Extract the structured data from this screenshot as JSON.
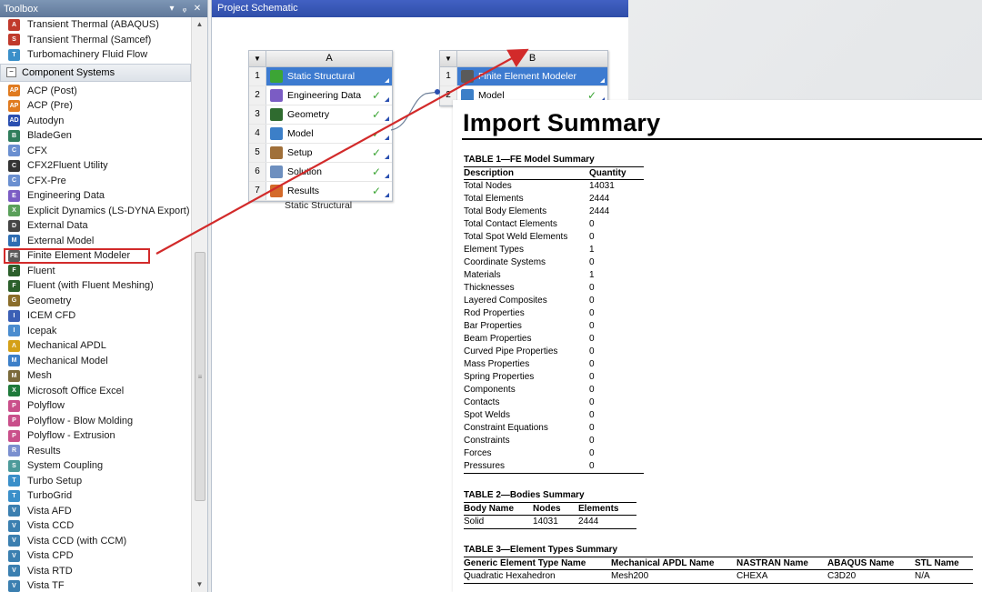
{
  "toolbox": {
    "title": "Toolbox",
    "pin_glyph": "▾",
    "dock_glyph": "ᵩ",
    "close_glyph": "✕",
    "top_items": [
      {
        "label": "Transient Thermal (ABAQUS)",
        "icon": "ansys-icon",
        "color": "#c0392b",
        "glyph": "A"
      },
      {
        "label": "Transient Thermal (Samcef)",
        "icon": "ansys-icon",
        "color": "#c0392b",
        "glyph": "S"
      },
      {
        "label": "Turbomachinery Fluid Flow",
        "icon": "turbo-icon",
        "color": "#3a8fc9",
        "glyph": "T"
      }
    ],
    "group": {
      "label": "Component Systems",
      "toggle": "−"
    },
    "items": [
      {
        "label": "ACP (Post)",
        "icon": "acp-icon",
        "color": "#e07b20",
        "glyph": "AP"
      },
      {
        "label": "ACP (Pre)",
        "icon": "acp-icon",
        "color": "#e07b20",
        "glyph": "AP"
      },
      {
        "label": "Autodyn",
        "icon": "autodyn-icon",
        "color": "#2a4fb0",
        "glyph": "AD"
      },
      {
        "label": "BladeGen",
        "icon": "bladegen-icon",
        "color": "#2f7d5b",
        "glyph": "B"
      },
      {
        "label": "CFX",
        "icon": "cfx-icon",
        "color": "#6a8fd0",
        "glyph": "C"
      },
      {
        "label": "CFX2Fluent Utility",
        "icon": "cfx2fluent-icon",
        "color": "#333333",
        "glyph": "C"
      },
      {
        "label": "CFX-Pre",
        "icon": "cfx-pre-icon",
        "color": "#6a8fd0",
        "glyph": "C"
      },
      {
        "label": "Engineering Data",
        "icon": "engineering-data-icon",
        "color": "#7b5cc4",
        "glyph": "E"
      },
      {
        "label": "Explicit Dynamics (LS-DYNA Export)",
        "icon": "explicit-dynamics-icon",
        "color": "#5aa05a",
        "glyph": "X"
      },
      {
        "label": "External Data",
        "icon": "external-data-icon",
        "color": "#444444",
        "glyph": "D"
      },
      {
        "label": "External Model",
        "icon": "external-model-icon",
        "color": "#2e6db3",
        "glyph": "M"
      },
      {
        "label": "Finite Element Modeler",
        "icon": "fe-modeler-icon",
        "color": "#5a5a5a",
        "glyph": "FE",
        "highlight": true
      },
      {
        "label": "Fluent",
        "icon": "fluent-icon",
        "color": "#2b5f2b",
        "glyph": "F"
      },
      {
        "label": "Fluent (with Fluent Meshing)",
        "icon": "fluent-icon",
        "color": "#2b5f2b",
        "glyph": "F"
      },
      {
        "label": "Geometry",
        "icon": "geometry-icon",
        "color": "#8a6d2a",
        "glyph": "G"
      },
      {
        "label": "ICEM CFD",
        "icon": "icem-icon",
        "color": "#3b5fb5",
        "glyph": "I"
      },
      {
        "label": "Icepak",
        "icon": "icepak-icon",
        "color": "#4a8ccf",
        "glyph": "I"
      },
      {
        "label": "Mechanical APDL",
        "icon": "mechanical-apdl-icon",
        "color": "#d4a017",
        "glyph": "Λ"
      },
      {
        "label": "Mechanical Model",
        "icon": "mechanical-model-icon",
        "color": "#3c7fc8",
        "glyph": "M"
      },
      {
        "label": "Mesh",
        "icon": "mesh-icon",
        "color": "#7a6a3a",
        "glyph": "M"
      },
      {
        "label": "Microsoft Office Excel",
        "icon": "excel-icon",
        "color": "#1e7a3a",
        "glyph": "X"
      },
      {
        "label": "Polyflow",
        "icon": "polyflow-icon",
        "color": "#c94f8a",
        "glyph": "P"
      },
      {
        "label": "Polyflow - Blow Molding",
        "icon": "polyflow-icon",
        "color": "#c94f8a",
        "glyph": "P"
      },
      {
        "label": "Polyflow - Extrusion",
        "icon": "polyflow-icon",
        "color": "#c94f8a",
        "glyph": "P"
      },
      {
        "label": "Results",
        "icon": "results-icon",
        "color": "#7a8fcf",
        "glyph": "R"
      },
      {
        "label": "System Coupling",
        "icon": "system-coupling-icon",
        "color": "#4c9a9a",
        "glyph": "S"
      },
      {
        "label": "Turbo Setup",
        "icon": "turbo-setup-icon",
        "color": "#3a8fc9",
        "glyph": "T"
      },
      {
        "label": "TurboGrid",
        "icon": "turbogrid-icon",
        "color": "#3a8fc9",
        "glyph": "T"
      },
      {
        "label": "Vista AFD",
        "icon": "vista-icon",
        "color": "#3b7fb0",
        "glyph": "V"
      },
      {
        "label": "Vista CCD",
        "icon": "vista-icon",
        "color": "#3b7fb0",
        "glyph": "V"
      },
      {
        "label": "Vista CCD (with CCM)",
        "icon": "vista-icon",
        "color": "#3b7fb0",
        "glyph": "V"
      },
      {
        "label": "Vista CPD",
        "icon": "vista-icon",
        "color": "#3b7fb0",
        "glyph": "V"
      },
      {
        "label": "Vista RTD",
        "icon": "vista-icon",
        "color": "#3b7fb0",
        "glyph": "V"
      },
      {
        "label": "Vista TF",
        "icon": "vista-icon",
        "color": "#3b7fb0",
        "glyph": "V"
      }
    ],
    "scroll_up": "▲",
    "scroll_down": "▼",
    "scroll_grip": "≡"
  },
  "schematic": {
    "title": "Project Schematic",
    "system_a": {
      "letter": "A",
      "caption": "Static Structural",
      "rows": [
        {
          "num": "1",
          "label": "Static Structural",
          "icon": "static-structural-icon",
          "color": "#3ca535",
          "title": true
        },
        {
          "num": "2",
          "label": "Engineering Data",
          "icon": "engineering-data-icon",
          "color": "#7b5cc4",
          "status": "✓"
        },
        {
          "num": "3",
          "label": "Geometry",
          "icon": "geometry-icon",
          "color": "#2f6b2f",
          "status": "✓"
        },
        {
          "num": "4",
          "label": "Model",
          "icon": "model-icon",
          "color": "#3c7fc8",
          "status": "✓"
        },
        {
          "num": "5",
          "label": "Setup",
          "icon": "setup-icon",
          "color": "#a0703a",
          "status": "✓"
        },
        {
          "num": "6",
          "label": "Solution",
          "icon": "solution-icon",
          "color": "#6d8fbf",
          "status": "✓"
        },
        {
          "num": "7",
          "label": "Results",
          "icon": "results-icon",
          "color": "#d46a2a",
          "status": "✓"
        }
      ]
    },
    "system_b": {
      "letter": "B",
      "rows": [
        {
          "num": "1",
          "label": "Finite Element Modeler",
          "icon": "fe-modeler-icon",
          "color": "#5a5a5a",
          "title": true
        },
        {
          "num": "2",
          "label": "Model",
          "icon": "model-icon",
          "color": "#3c7fc8",
          "status": "✓"
        }
      ]
    }
  },
  "summary": {
    "title": "Import Summary",
    "table1": {
      "caption": "TABLE 1—FE Model Summary",
      "headers": [
        "Description",
        "Quantity"
      ],
      "rows": [
        [
          "Total Nodes",
          "14031"
        ],
        [
          "Total Elements",
          "2444"
        ],
        [
          "Total Body Elements",
          "2444"
        ],
        [
          "Total Contact Elements",
          "0"
        ],
        [
          "Total Spot Weld Elements",
          "0"
        ],
        [
          "Element Types",
          "1"
        ],
        [
          "Coordinate Systems",
          "0"
        ],
        [
          "Materials",
          "1"
        ],
        [
          "Thicknesses",
          "0"
        ],
        [
          "Layered Composites",
          "0"
        ],
        [
          "Rod Properties",
          "0"
        ],
        [
          "Bar Properties",
          "0"
        ],
        [
          "Beam Properties",
          "0"
        ],
        [
          "Curved Pipe Properties",
          "0"
        ],
        [
          "Mass Properties",
          "0"
        ],
        [
          "Spring Properties",
          "0"
        ],
        [
          "Components",
          "0"
        ],
        [
          "Contacts",
          "0"
        ],
        [
          "Spot Welds",
          "0"
        ],
        [
          "Constraint Equations",
          "0"
        ],
        [
          "Constraints",
          "0"
        ],
        [
          "Forces",
          "0"
        ],
        [
          "Pressures",
          "0"
        ]
      ]
    },
    "table2": {
      "caption": "TABLE 2—Bodies Summary",
      "headers": [
        "Body Name",
        "Nodes",
        "Elements"
      ],
      "rows": [
        [
          "Solid",
          "14031",
          "2444"
        ]
      ]
    },
    "table3": {
      "caption": "TABLE 3—Element Types Summary",
      "headers": [
        "Generic Element Type Name",
        "Mechanical APDL Name",
        "NASTRAN Name",
        "ABAQUS Name",
        "STL Name"
      ],
      "rows": [
        [
          "Quadratic Hexahedron",
          "Mesh200",
          "CHEXA",
          "C3D20",
          "N/A"
        ]
      ]
    }
  },
  "colors": {
    "arrow": "#d22a2a",
    "title_row": "#3d7bd0",
    "check": "#3ca535"
  }
}
